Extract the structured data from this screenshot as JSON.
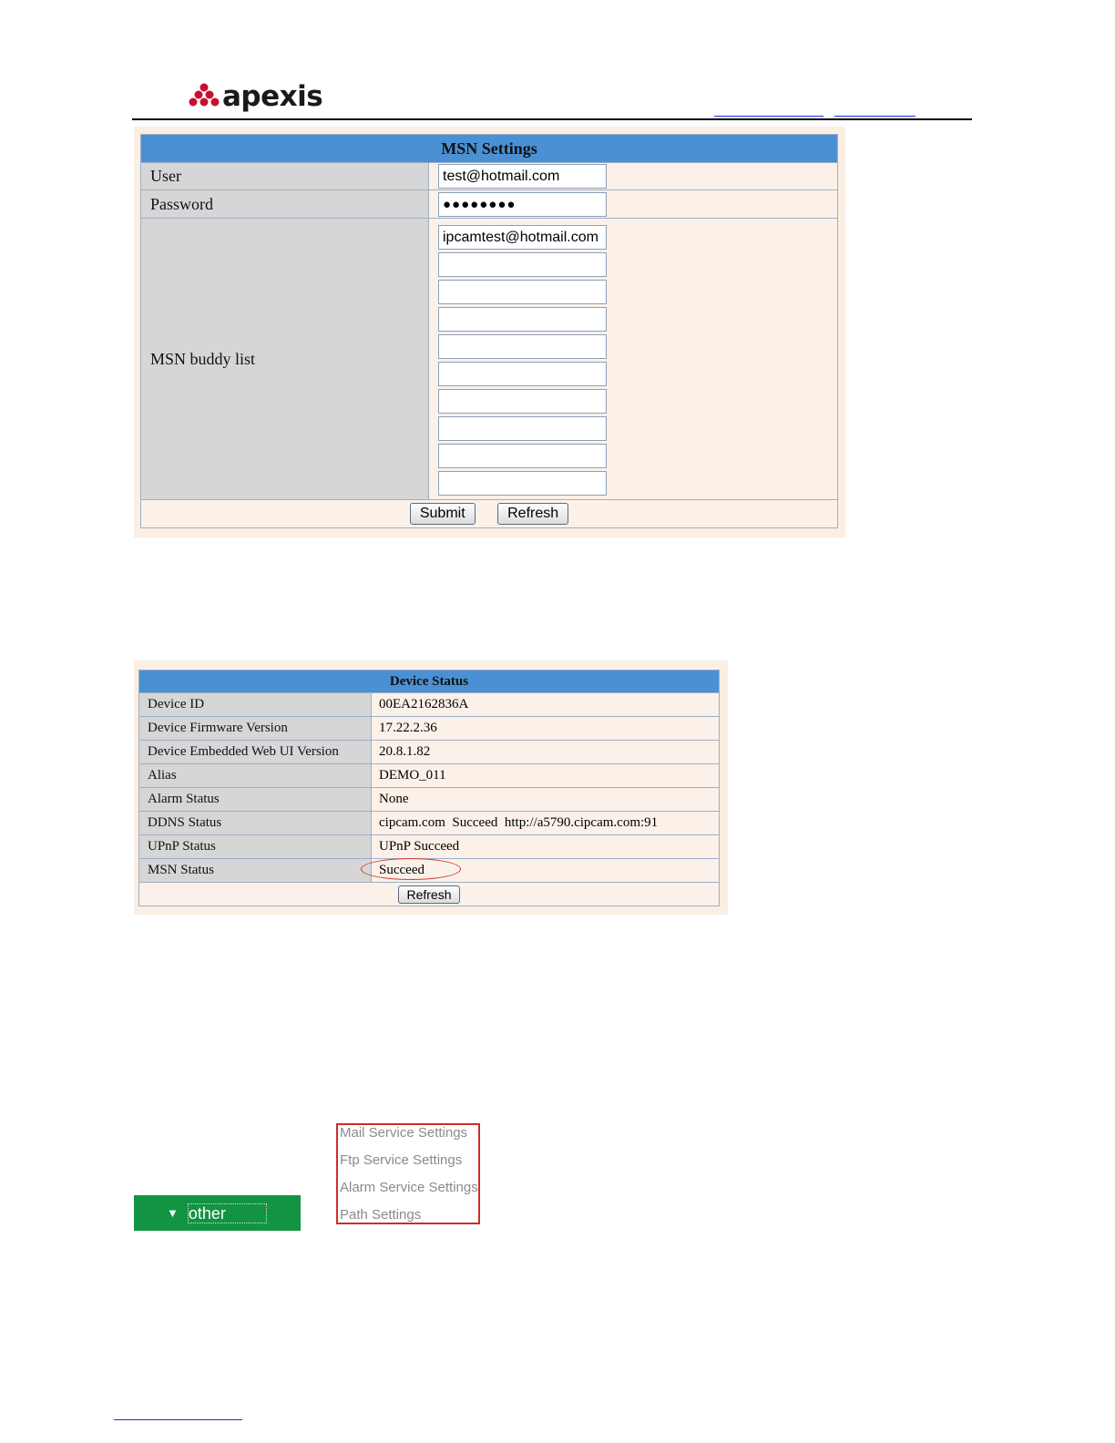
{
  "header": {
    "logo_text": "apexis",
    "logo_icon": "apexis-logo-icon"
  },
  "msn_settings": {
    "title": "MSN Settings",
    "user_label": "User",
    "user_value": "test@hotmail.com",
    "password_label": "Password",
    "password_value": "●●●●●●●●",
    "buddy_label": "MSN buddy list",
    "buddies": [
      "ipcamtest@hotmail.com",
      "",
      "",
      "",
      "",
      "",
      "",
      "",
      "",
      ""
    ],
    "submit_label": "Submit",
    "refresh_label": "Refresh"
  },
  "device_status": {
    "title": "Device Status",
    "rows": [
      {
        "label": "Device ID",
        "value": "00EA2162836A"
      },
      {
        "label": "Device Firmware Version",
        "value": "17.22.2.36"
      },
      {
        "label": "Device Embedded Web UI Version",
        "value": "20.8.1.82"
      },
      {
        "label": "Alias",
        "value": "DEMO_011"
      },
      {
        "label": "Alarm Status",
        "value": "None"
      },
      {
        "label": "DDNS Status",
        "value": "cipcam.com  Succeed  http://a5790.cipcam.com:91"
      },
      {
        "label": "UPnP Status",
        "value": "UPnP Succeed"
      },
      {
        "label": "MSN Status",
        "value": "Succeed"
      }
    ],
    "refresh_label": "Refresh",
    "highlight_color": "#d23a3a"
  },
  "menu": {
    "other_label": "other",
    "other_icon": "triangle-down-icon",
    "items": [
      "Mail Service Settings",
      "Ftp Service Settings",
      "Alarm Service Settings",
      "Path Settings"
    ],
    "bar_color": "#129442",
    "box_color": "#d22a2a"
  }
}
